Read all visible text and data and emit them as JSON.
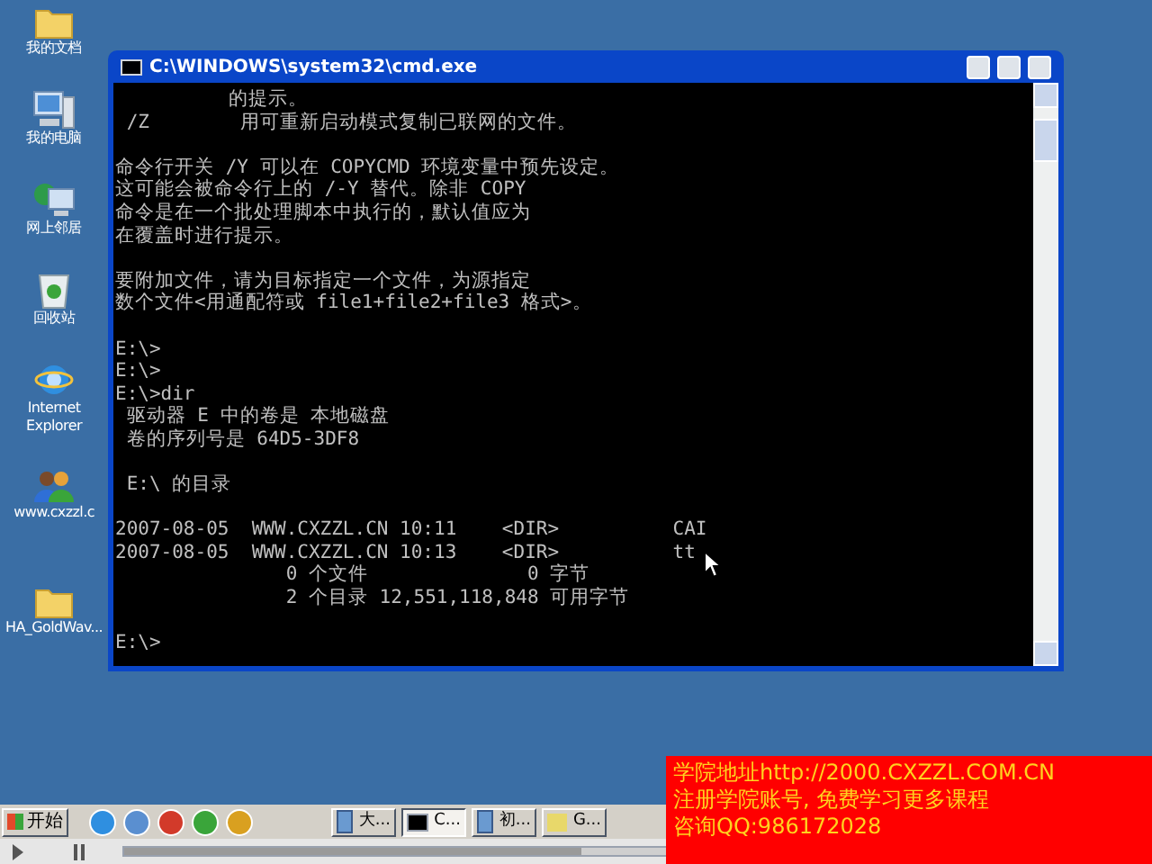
{
  "desktop_icons": [
    {
      "label": "我的文档",
      "kind": "folder-doc"
    },
    {
      "label": "我的电脑",
      "kind": "computer"
    },
    {
      "label": "网上邻居",
      "kind": "network"
    },
    {
      "label": "回收站",
      "kind": "bin"
    },
    {
      "label": "Internet Explorer",
      "kind": "ie"
    },
    {
      "label": "www.cxzzl.c",
      "kind": "people"
    },
    {
      "label": "HA_GoldWav...",
      "kind": "folder"
    }
  ],
  "console": {
    "title": "C:\\WINDOWS\\system32\\cmd.exe",
    "blocks": [
      [
        "          的提示。",
        " /Z        用可重新启动模式复制已联网的文件。"
      ],
      [
        "命令行开关 /Y 可以在 COPYCMD 环境变量中预先设定。",
        "这可能会被命令行上的 /-Y 替代。除非 COPY",
        "命令是在一个批处理脚本中执行的，默认值应为",
        "在覆盖时进行提示。"
      ],
      [
        "要附加文件，请为目标指定一个文件，为源指定",
        "数个文件<用通配符或 file1+file2+file3 格式>。"
      ],
      [
        "E:\\>",
        "E:\\>",
        "E:\\>dir",
        " 驱动器 E 中的卷是 本地磁盘",
        " 卷的序列号是 64D5-3DF8"
      ],
      [
        " E:\\ 的目录"
      ],
      [
        "2007-08-05  WWW.CXZZL.CN 10:11    <DIR>          CAI",
        "2007-08-05  WWW.CXZZL.CN 10:13    <DIR>          tt",
        "               0 个文件              0 字节",
        "               2 个目录 12,551,118,848 可用字节"
      ],
      [
        "E:\\>"
      ]
    ]
  },
  "taskbar": {
    "start": "开始",
    "tasks": [
      {
        "label": "大...",
        "selected": false,
        "kind": "doc"
      },
      {
        "label": "C...",
        "selected": true,
        "kind": "cmd"
      },
      {
        "label": "初...",
        "selected": false,
        "kind": "doc"
      },
      {
        "label": "G...",
        "selected": false,
        "kind": "wave"
      }
    ]
  },
  "player": {
    "level": 0.45
  },
  "overlay": [
    "学院地址http://2000.CXZZL.COM.CN",
    "注册学院账号, 免费学习更多课程",
    "咨询QQ:986172028"
  ]
}
